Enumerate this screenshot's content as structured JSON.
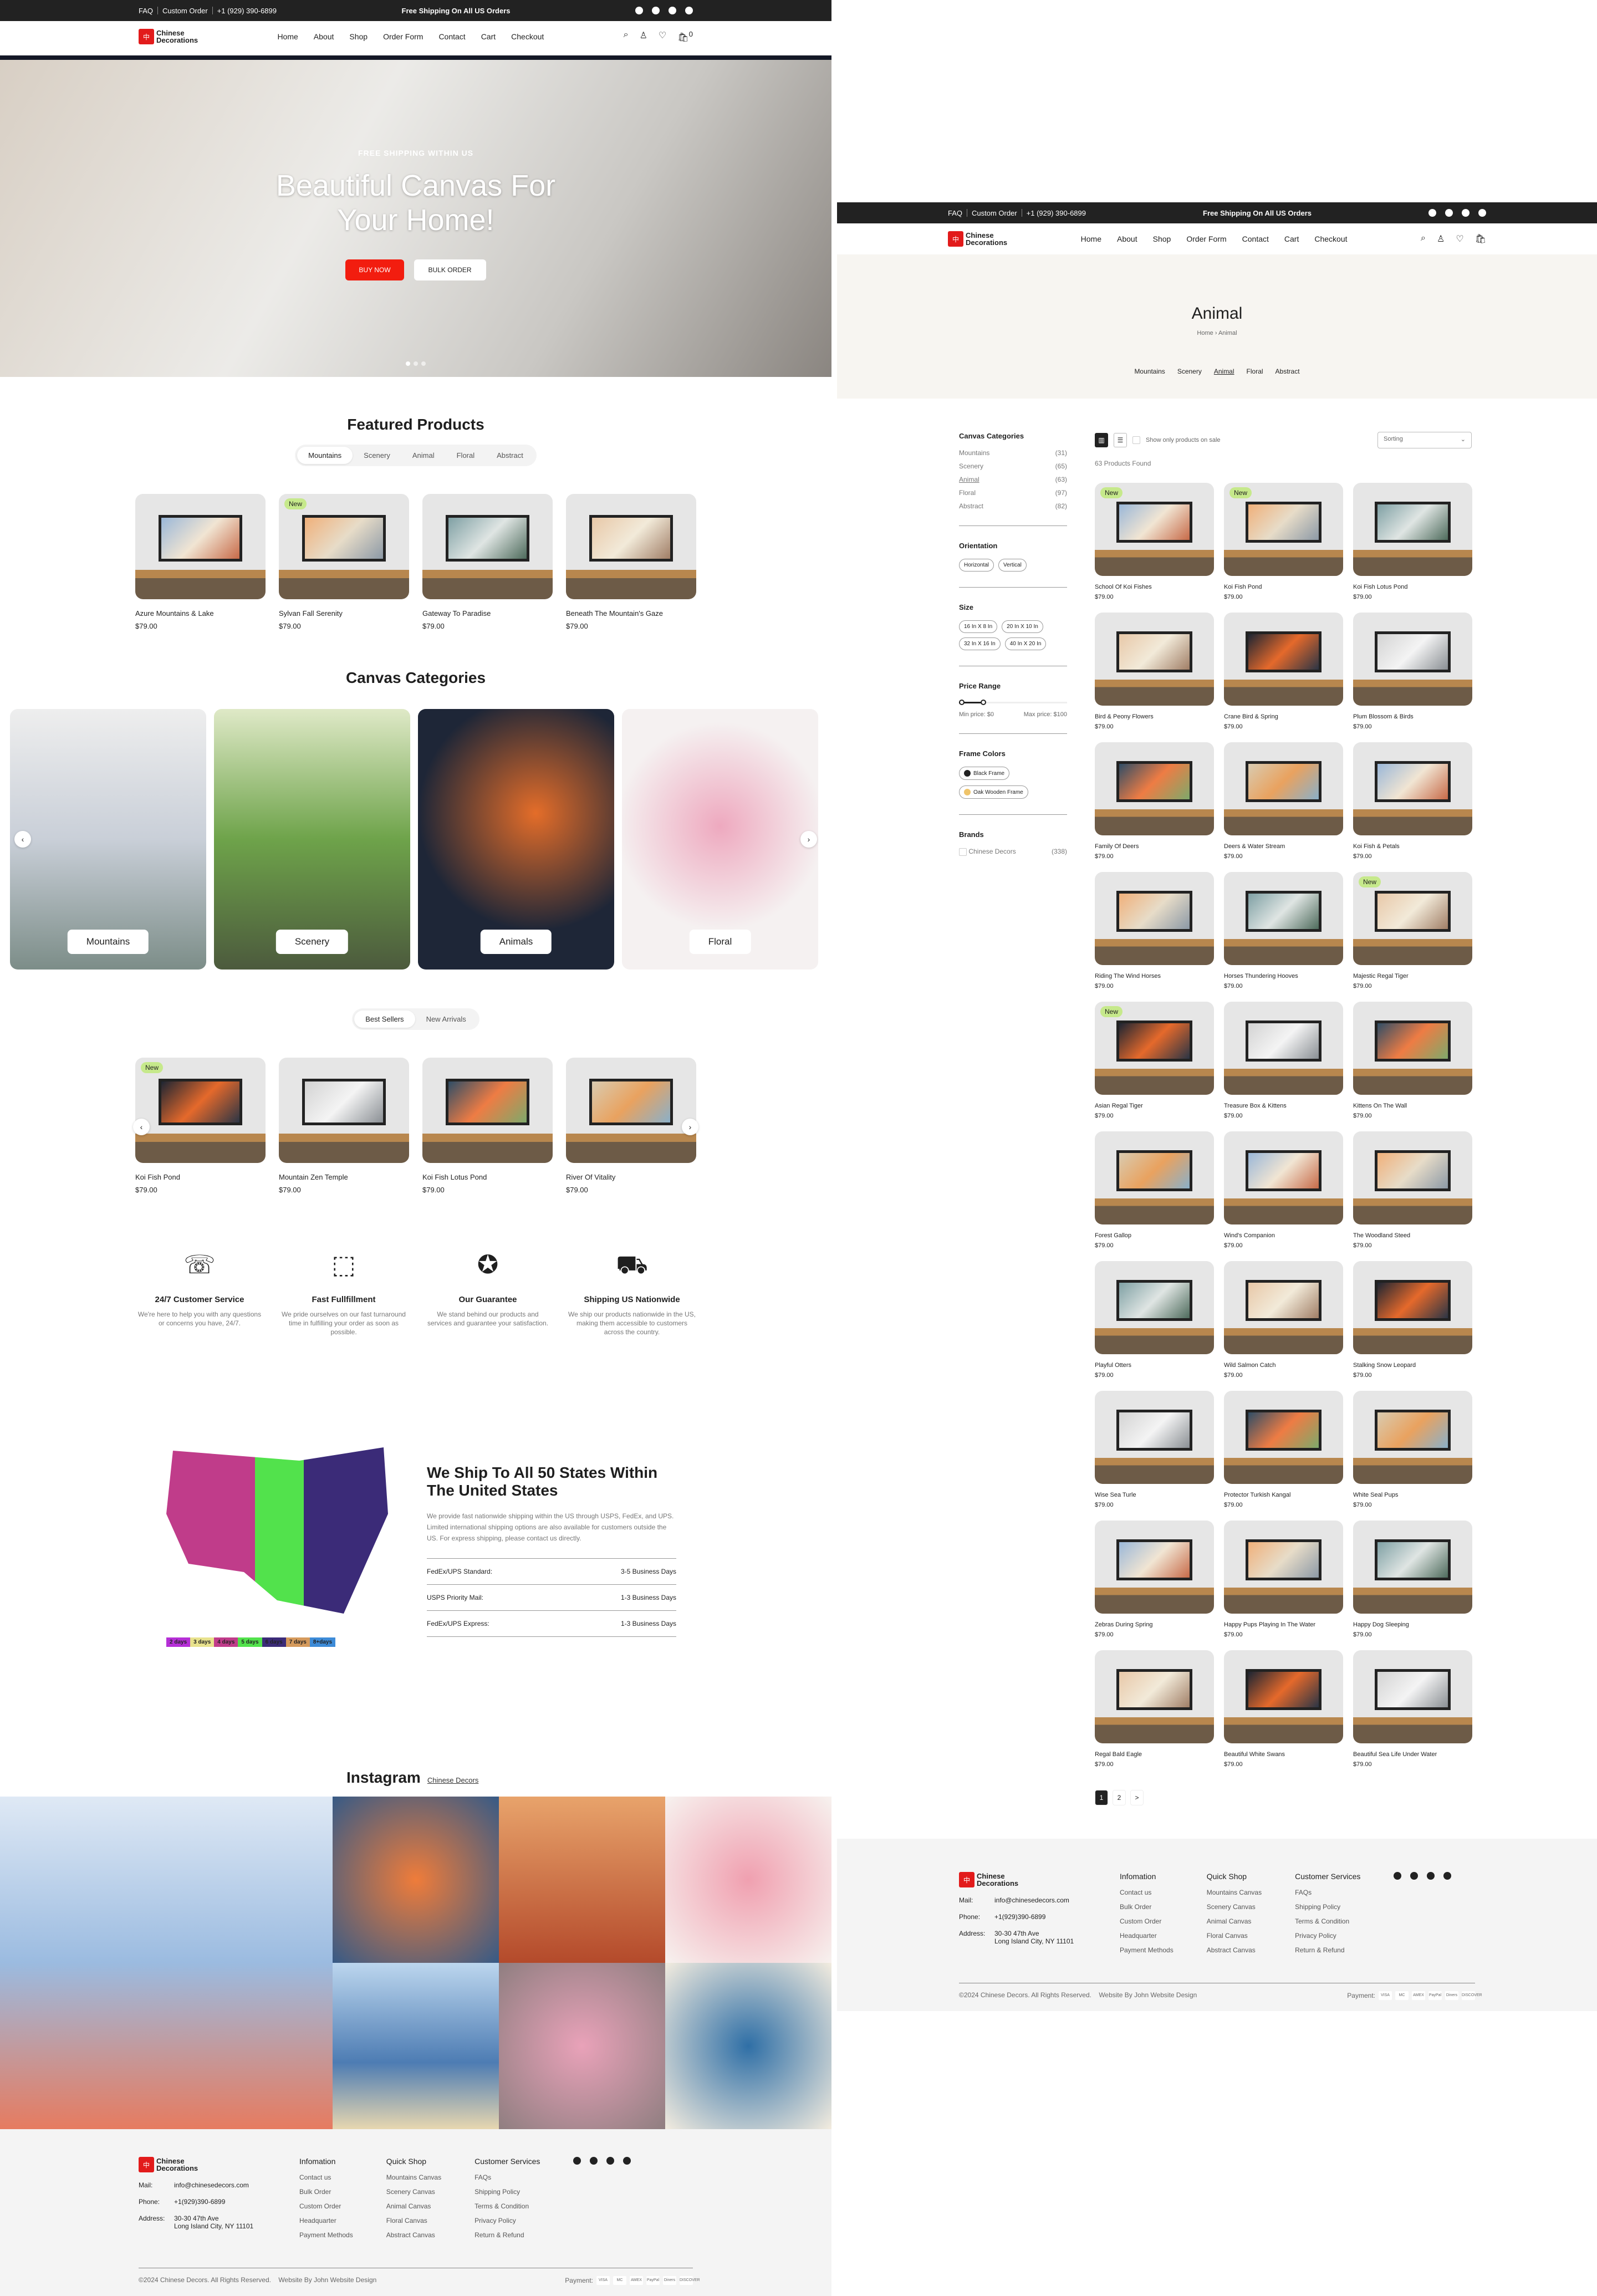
{
  "topbar": {
    "faq": "FAQ",
    "custom_order": "Custom Order",
    "phone": "+1 (929) 390-6899",
    "promo": "Free Shipping On All US Orders",
    "social": [
      "facebook-icon",
      "instagram-icon",
      "youtube-icon",
      "tiktok-icon"
    ]
  },
  "brand": {
    "line1": "Chinese",
    "line2": "Decorations",
    "mark": "中"
  },
  "nav": [
    "Home",
    "About",
    "Shop",
    "Order Form",
    "Contact",
    "Cart",
    "Checkout"
  ],
  "cart_count": "0",
  "hero": {
    "kicker": "FREE SHIPPING WITHIN US",
    "title": "Beautiful Canvas For Your Home!",
    "buy": "BUY NOW",
    "bulk": "BULK ORDER",
    "slides": 3,
    "active_slide": 1
  },
  "featured": {
    "title": "Featured Products",
    "tabs": [
      "Mountains",
      "Scenery",
      "Animal",
      "Floral",
      "Abstract"
    ],
    "active": "Mountains",
    "items": [
      {
        "name": "Azure Mountains & Lake",
        "price": "$79.00",
        "badge": ""
      },
      {
        "name": "Sylvan Fall Serenity",
        "price": "$79.00",
        "badge": "New"
      },
      {
        "name": "Gateway To Paradise",
        "price": "$79.00",
        "badge": ""
      },
      {
        "name": "Beneath The Mountain's Gaze",
        "price": "$79.00",
        "badge": ""
      }
    ]
  },
  "categories": {
    "title": "Canvas Categories",
    "items": [
      "Mountains",
      "Scenery",
      "Animals",
      "Floral"
    ]
  },
  "bestsellers": {
    "tabs": [
      "Best Sellers",
      "New Arrivals"
    ],
    "active": "Best Sellers",
    "items": [
      {
        "name": "Koi Fish Pond",
        "price": "$79.00",
        "badge": "New"
      },
      {
        "name": "Mountain Zen Temple",
        "price": "$79.00",
        "badge": ""
      },
      {
        "name": "Koi Fish Lotus Pond",
        "price": "$79.00",
        "badge": ""
      },
      {
        "name": "River Of Vitality",
        "price": "$79.00",
        "badge": ""
      }
    ]
  },
  "features": [
    {
      "icon": "phone-chat-icon",
      "title": "24/7 Customer Service",
      "text": "We're here to help you with any questions or concerns you have, 24/7."
    },
    {
      "icon": "box-return-icon",
      "title": "Fast Fullfillment",
      "text": "We pride ourselves on our fast turnaround time in fulfilling your order as soon as possible."
    },
    {
      "icon": "badge-check-icon",
      "title": "Our Guarantee",
      "text": "We stand behind our products and services and guarantee your satisfaction."
    },
    {
      "icon": "truck-icon",
      "title": "Shipping US Nationwide",
      "text": "We ship our products nationwide in the US, making them accessible to customers across the country."
    }
  ],
  "shipping": {
    "title": "We Ship To All 50 States Within The United States",
    "text": "We provide fast nationwide shipping within the US through USPS, FedEx, and UPS. Limited international shipping options are also available for customers outside the US. For express shipping, please contact us directly.",
    "rows": [
      {
        "label": "FedEx/UPS Standard:",
        "value": "3-5 Business Days"
      },
      {
        "label": "USPS Priority Mail:",
        "value": "1-3 Business Days"
      },
      {
        "label": "FedEx/UPS Express:",
        "value": "1-3 Business Days"
      }
    ],
    "legend": [
      {
        "label": "2 days",
        "color": "#b52fd6"
      },
      {
        "label": "3 days",
        "color": "#e8e28d"
      },
      {
        "label": "4 days",
        "color": "#c03c8a"
      },
      {
        "label": "5 days",
        "color": "#52e24c"
      },
      {
        "label": "6 days",
        "color": "#3b2b78"
      },
      {
        "label": "7 days",
        "color": "#d59a5c"
      },
      {
        "label": "8+days",
        "color": "#3d8bd8"
      }
    ]
  },
  "instagram": {
    "title": "Instagram",
    "link": "Chinese Decors"
  },
  "footer": {
    "mail_label": "Mail:",
    "mail": "info@chinesedecors.com",
    "phone_label": "Phone:",
    "phone": "+1(929)390-6899",
    "address_label": "Address:",
    "address1": "30-30 47th Ave",
    "address2": "Long Island City, NY 11101",
    "cols": [
      {
        "title": "Infomation",
        "links": [
          "Contact us",
          "Bulk Order",
          "Custom Order",
          "Headquarter",
          "Payment Methods"
        ]
      },
      {
        "title": "Quick Shop",
        "links": [
          "Mountains Canvas",
          "Scenery Canvas",
          "Animal Canvas",
          "Floral Canvas",
          "Abstract Canvas"
        ]
      },
      {
        "title": "Customer Services",
        "links": [
          "FAQs",
          "Shipping Policy",
          "Terms & Condition",
          "Privacy Policy",
          "Return & Refund"
        ]
      }
    ],
    "copyright": "©2024 Chinese Decors. All Rights Reserved.",
    "credit": "Website By John Website Design",
    "payment_label": "Payment:",
    "payments": [
      "VISA",
      "MC",
      "AMEX",
      "PayPal",
      "Diners",
      "DISCOVER"
    ]
  },
  "shop": {
    "title": "Animal",
    "breadcrumb": [
      "Home",
      "Animal"
    ],
    "subnav": [
      "Mountains",
      "Scenery",
      "Animal",
      "Floral",
      "Abstract"
    ],
    "active": "Animal",
    "sidebar": {
      "categories_title": "Canvas Categories",
      "categories": [
        {
          "name": "Mountains",
          "count": "(31)"
        },
        {
          "name": "Scenery",
          "count": "(65)"
        },
        {
          "name": "Animal",
          "count": "(63)"
        },
        {
          "name": "Floral",
          "count": "(97)"
        },
        {
          "name": "Abstract",
          "count": "(82)"
        }
      ],
      "orientation_title": "Orientation",
      "orientations": [
        "Horizontal",
        "Vertical"
      ],
      "size_title": "Size",
      "sizes": [
        "16 In X 8 In",
        "20 In X 10 In",
        "32 In X 16 In",
        "40 In X 20 In"
      ],
      "price_title": "Price Range",
      "min_price": "Min price: $0",
      "max_price": "Max price: $100",
      "price_min_value": 0,
      "price_max_value": 100,
      "frame_title": "Frame Colors",
      "frames": [
        {
          "name": "Black Frame",
          "color": "#222222"
        },
        {
          "name": "Oak Wooden Frame",
          "color": "#efc46a"
        }
      ],
      "brands_title": "Brands",
      "brands": [
        {
          "name": "Chinese Decors",
          "count": "(338)"
        }
      ]
    },
    "sale_label": "Show only products on sale",
    "sorting": "Sorting",
    "found": "63 Products Found",
    "products": [
      {
        "name": "School Of Koi Fishes",
        "price": "$79.00",
        "badge": "New"
      },
      {
        "name": "Koi Fish Pond",
        "price": "$79.00",
        "badge": "New"
      },
      {
        "name": "Koi Fish Lotus Pond",
        "price": "$79.00",
        "badge": ""
      },
      {
        "name": "Bird & Peony Flowers",
        "price": "$79.00",
        "badge": ""
      },
      {
        "name": "Crane Bird & Spring",
        "price": "$79.00",
        "badge": ""
      },
      {
        "name": "Plum Blossom & Birds",
        "price": "$79.00",
        "badge": ""
      },
      {
        "name": "Family Of Deers",
        "price": "$79.00",
        "badge": ""
      },
      {
        "name": "Deers & Water Stream",
        "price": "$79.00",
        "badge": ""
      },
      {
        "name": "Koi Fish & Petals",
        "price": "$79.00",
        "badge": ""
      },
      {
        "name": "Riding The Wind Horses",
        "price": "$79.00",
        "badge": ""
      },
      {
        "name": "Horses Thundering Hooves",
        "price": "$79.00",
        "badge": ""
      },
      {
        "name": "Majestic Regal Tiger",
        "price": "$79.00",
        "badge": "New"
      },
      {
        "name": "Asian Regal Tiger",
        "price": "$79.00",
        "badge": "New"
      },
      {
        "name": "Treasure Box & Kittens",
        "price": "$79.00",
        "badge": ""
      },
      {
        "name": "Kittens On The Wall",
        "price": "$79.00",
        "badge": ""
      },
      {
        "name": "Forest Gallop",
        "price": "$79.00",
        "badge": ""
      },
      {
        "name": "Wind's Companion",
        "price": "$79.00",
        "badge": ""
      },
      {
        "name": "The Woodland Steed",
        "price": "$79.00",
        "badge": ""
      },
      {
        "name": "Playful Otters",
        "price": "$79.00",
        "badge": ""
      },
      {
        "name": "Wild Salmon Catch",
        "price": "$79.00",
        "badge": ""
      },
      {
        "name": "Stalking Snow Leopard",
        "price": "$79.00",
        "badge": ""
      },
      {
        "name": "Wise Sea Turle",
        "price": "$79.00",
        "badge": ""
      },
      {
        "name": "Protector Turkish Kangal",
        "price": "$79.00",
        "badge": ""
      },
      {
        "name": "White Seal Pups",
        "price": "$79.00",
        "badge": ""
      },
      {
        "name": "Zebras During Spring",
        "price": "$79.00",
        "badge": ""
      },
      {
        "name": "Happy Pups Playing In The Water",
        "price": "$79.00",
        "badge": ""
      },
      {
        "name": "Happy Dog Sleeping",
        "price": "$79.00",
        "badge": ""
      },
      {
        "name": "Regal Bald Eagle",
        "price": "$79.00",
        "badge": ""
      },
      {
        "name": "Beautiful White Swans",
        "price": "$79.00",
        "badge": ""
      },
      {
        "name": "Beautiful Sea Life Under Water",
        "price": "$79.00",
        "badge": ""
      }
    ],
    "pages": [
      "1",
      "2",
      ">"
    ],
    "current_page": "1"
  }
}
